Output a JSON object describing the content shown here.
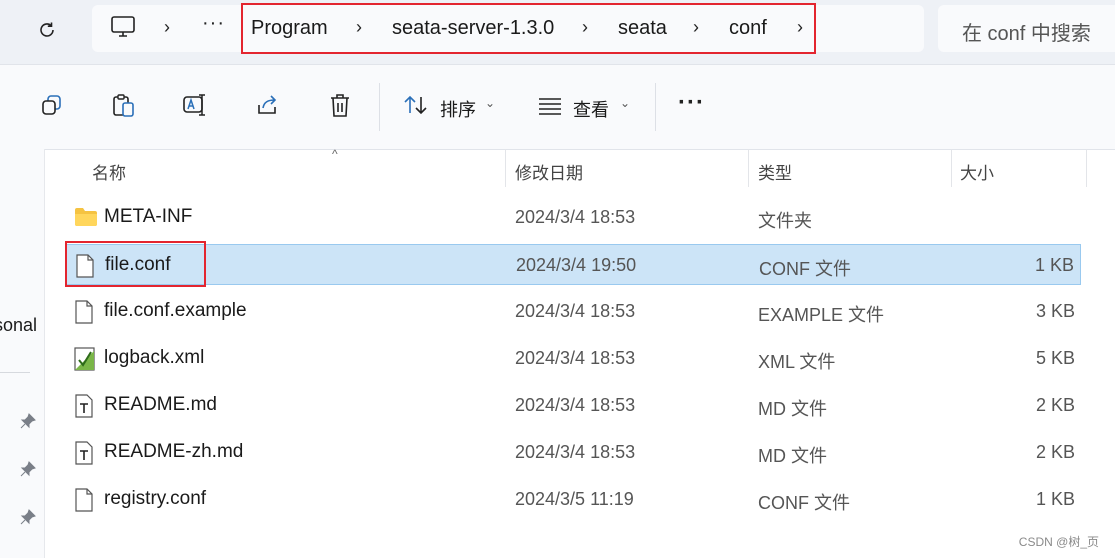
{
  "address_bar": {
    "crumbs": [
      "Program",
      "seata-server-1.3.0",
      "seata",
      "conf"
    ],
    "overflow": "···"
  },
  "search": {
    "placeholder": "在 conf 中搜索"
  },
  "toolbar": {
    "sort_label": "排序",
    "view_label": "查看",
    "more": "···"
  },
  "left_nav": {
    "partial_label": "sonal"
  },
  "columns": {
    "name": "名称",
    "date": "修改日期",
    "type": "类型",
    "size": "大小"
  },
  "files": [
    {
      "name": "META-INF",
      "date": "2024/3/4 18:53",
      "type": "文件夹",
      "size": "",
      "icon": "folder-icon"
    },
    {
      "name": "file.conf",
      "date": "2024/3/4 19:50",
      "type": "CONF 文件",
      "size": "1 KB",
      "icon": "file-icon",
      "selected": true
    },
    {
      "name": "file.conf.example",
      "date": "2024/3/4 18:53",
      "type": "EXAMPLE 文件",
      "size": "3 KB",
      "icon": "file-icon"
    },
    {
      "name": "logback.xml",
      "date": "2024/3/4 18:53",
      "type": "XML 文件",
      "size": "5 KB",
      "icon": "xml-file-icon"
    },
    {
      "name": "README.md",
      "date": "2024/3/4 18:53",
      "type": "MD 文件",
      "size": "2 KB",
      "icon": "text-file-icon"
    },
    {
      "name": "README-zh.md",
      "date": "2024/3/4 18:53",
      "type": "MD 文件",
      "size": "2 KB",
      "icon": "text-file-icon"
    },
    {
      "name": "registry.conf",
      "date": "2024/3/5 11:19",
      "type": "CONF 文件",
      "size": "1 KB",
      "icon": "file-icon"
    }
  ],
  "watermark": "CSDN @树_页",
  "colors": {
    "highlight_border": "#e3252f",
    "selected_row": "#cce4f7",
    "address_bg": "#eef1f6"
  }
}
